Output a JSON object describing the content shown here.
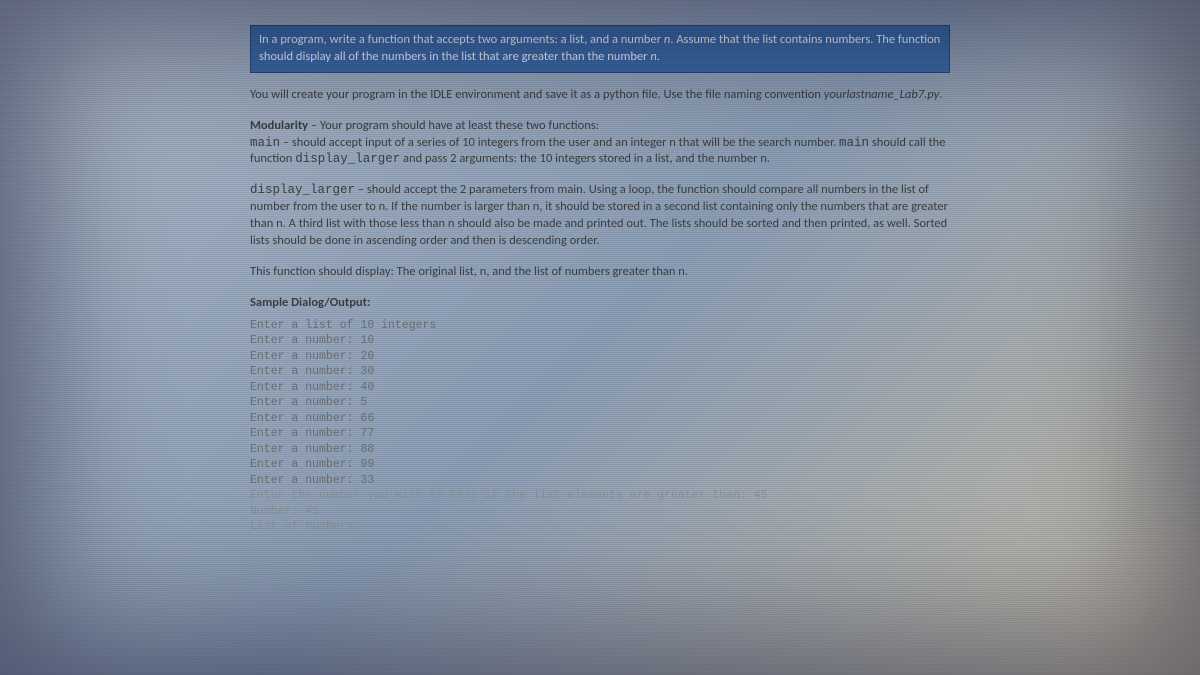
{
  "highlight": {
    "line1_a": "In a program, write a function that accepts two arguments: a list, and a number ",
    "line1_n": "n",
    "line1_b": ". Assume that the list contains numbers. The function should display all of the numbers in the list that are greater than the number ",
    "line1_c": "."
  },
  "para1": {
    "a": "You will create your program in the IDLE environment and save it as a python file. Use the file naming convention ",
    "filename": "yourlastname_Lab7.py",
    "b": "."
  },
  "modularity": {
    "heading": "Modularity",
    "lead": " – Your program should have at least these two functions:",
    "main_kw": "main",
    "main_a": " – should accept input of a series of 10 integers from the user and an integer n that will be the search number. ",
    "main_b": " should call the function ",
    "disp_kw": "display_larger",
    "main_c": " and pass 2 arguments: the 10 integers stored in a list, and the number n."
  },
  "display_para": {
    "kw": "display_larger",
    "a": " – should accept the 2 parameters from main. Using a loop, the function should compare all numbers in the list of number from the user to n. If the number is larger than n, it should be stored in a second list containing only the numbers that are greater than n. A third list with those less than n should also be made and printed out. The lists should be sorted and then printed, as well. Sorted lists should be done in ascending order and then is descending order."
  },
  "should_display": "This function should display: The original list, n, and the list of numbers greater than n.",
  "sample_heading": "Sample Dialog/Output:",
  "sample": {
    "l0": "Enter a list of 10 integers",
    "l1": "Enter a number: 10",
    "l2": "Enter a number: 20",
    "l3": "Enter a number: 30",
    "l4": "Enter a number: 40",
    "l5": "Enter a number: 5",
    "l6": "Enter a number: 66",
    "l7": "Enter a number: 77",
    "l8": "Enter a number: 88",
    "l9": "Enter a number: 99",
    "l10": "Enter a number: 33",
    "l11": "Enter the number you wish to test if the list elements are greater than: 45",
    "l12": "Number: 45",
    "l13": "List of numbers:"
  }
}
